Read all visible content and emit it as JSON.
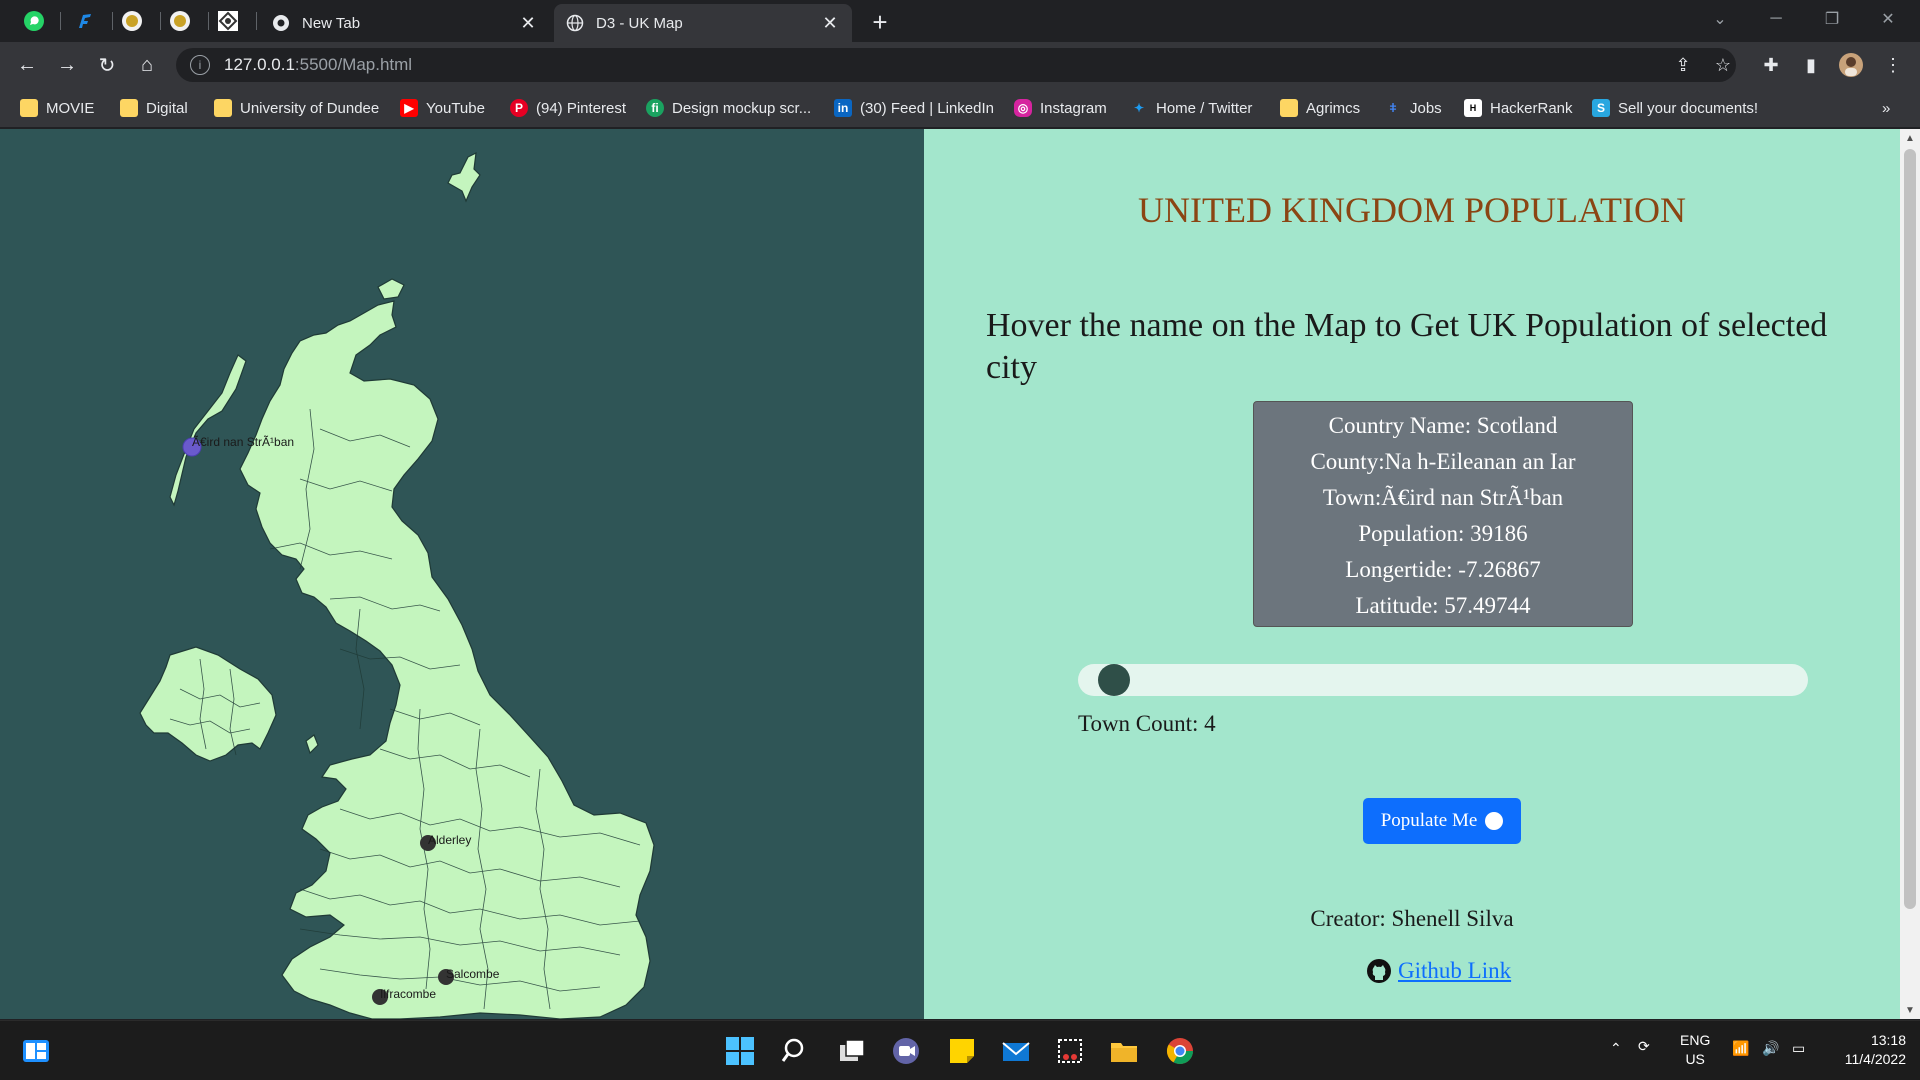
{
  "browser": {
    "tabs": [
      {
        "title": "New Tab",
        "active": false
      },
      {
        "title": "D3 - UK Map",
        "active": true
      }
    ],
    "url_host": "127.0.0.1",
    "url_path": ":5500/Map.html",
    "bookmarks": [
      {
        "label": "MOVIE",
        "icon": "folder-icon"
      },
      {
        "label": "Digital",
        "icon": "folder-icon"
      },
      {
        "label": "University of Dundee",
        "icon": "folder-icon"
      },
      {
        "label": "YouTube",
        "icon": "youtube-icon"
      },
      {
        "label": "(94) Pinterest",
        "icon": "pinterest-icon"
      },
      {
        "label": "Design mockup scr...",
        "icon": "fi-icon"
      },
      {
        "label": "(30) Feed | LinkedIn",
        "icon": "linkedin-icon"
      },
      {
        "label": "Instagram",
        "icon": "instagram-icon"
      },
      {
        "label": "Home / Twitter",
        "icon": "twitter-icon"
      },
      {
        "label": "Agrimcs",
        "icon": "folder-icon"
      },
      {
        "label": "Jobs",
        "icon": "jobs-icon"
      },
      {
        "label": "HackerRank",
        "icon": "hackerrank-icon"
      },
      {
        "label": "Sell your documents!",
        "icon": "document-icon"
      }
    ],
    "more_bookmarks": "»"
  },
  "page": {
    "title": "UNITED KINGDOM POPULATION",
    "instructions": "Hover the name on the Map to Get UK Population of selected city",
    "tooltip": {
      "country": "Country Name: Scotland",
      "county": "County:Na h-Eileanan an Iar",
      "town": "Town:Ã€ird nan StrÃ¹ban",
      "population": "Population: 39186",
      "longitude": "Longertide: -7.26867",
      "latitude": "Latitude: 57.49744"
    },
    "slider": {
      "value": 4,
      "min": 0,
      "max": 100
    },
    "town_count": "Town Count: 4",
    "populate_button": "Populate Me",
    "creator": "Creator: Shenell Silva",
    "github_link": "Github Link"
  },
  "map": {
    "towns": [
      {
        "label": "Ã€ird nan StrÃ¹ban",
        "highlighted": true
      },
      {
        "label": "Alderley",
        "highlighted": false
      },
      {
        "label": "Salcombe",
        "highlighted": false
      },
      {
        "label": "Ilfracombe",
        "highlighted": false
      }
    ],
    "colors": {
      "ocean": "#2f5556",
      "land": "#c4f5be",
      "highlight": "#6a5acd",
      "dot": "#333333"
    }
  },
  "taskbar": {
    "apps": [
      "start-icon",
      "search-icon",
      "task-view-icon",
      "teams-chat-icon",
      "sticky-notes-icon",
      "mail-icon",
      "snipping-tool-icon",
      "file-explorer-icon",
      "chrome-icon"
    ],
    "language": "ENG",
    "region": "US",
    "time": "13:18",
    "date": "11/4/2022"
  }
}
